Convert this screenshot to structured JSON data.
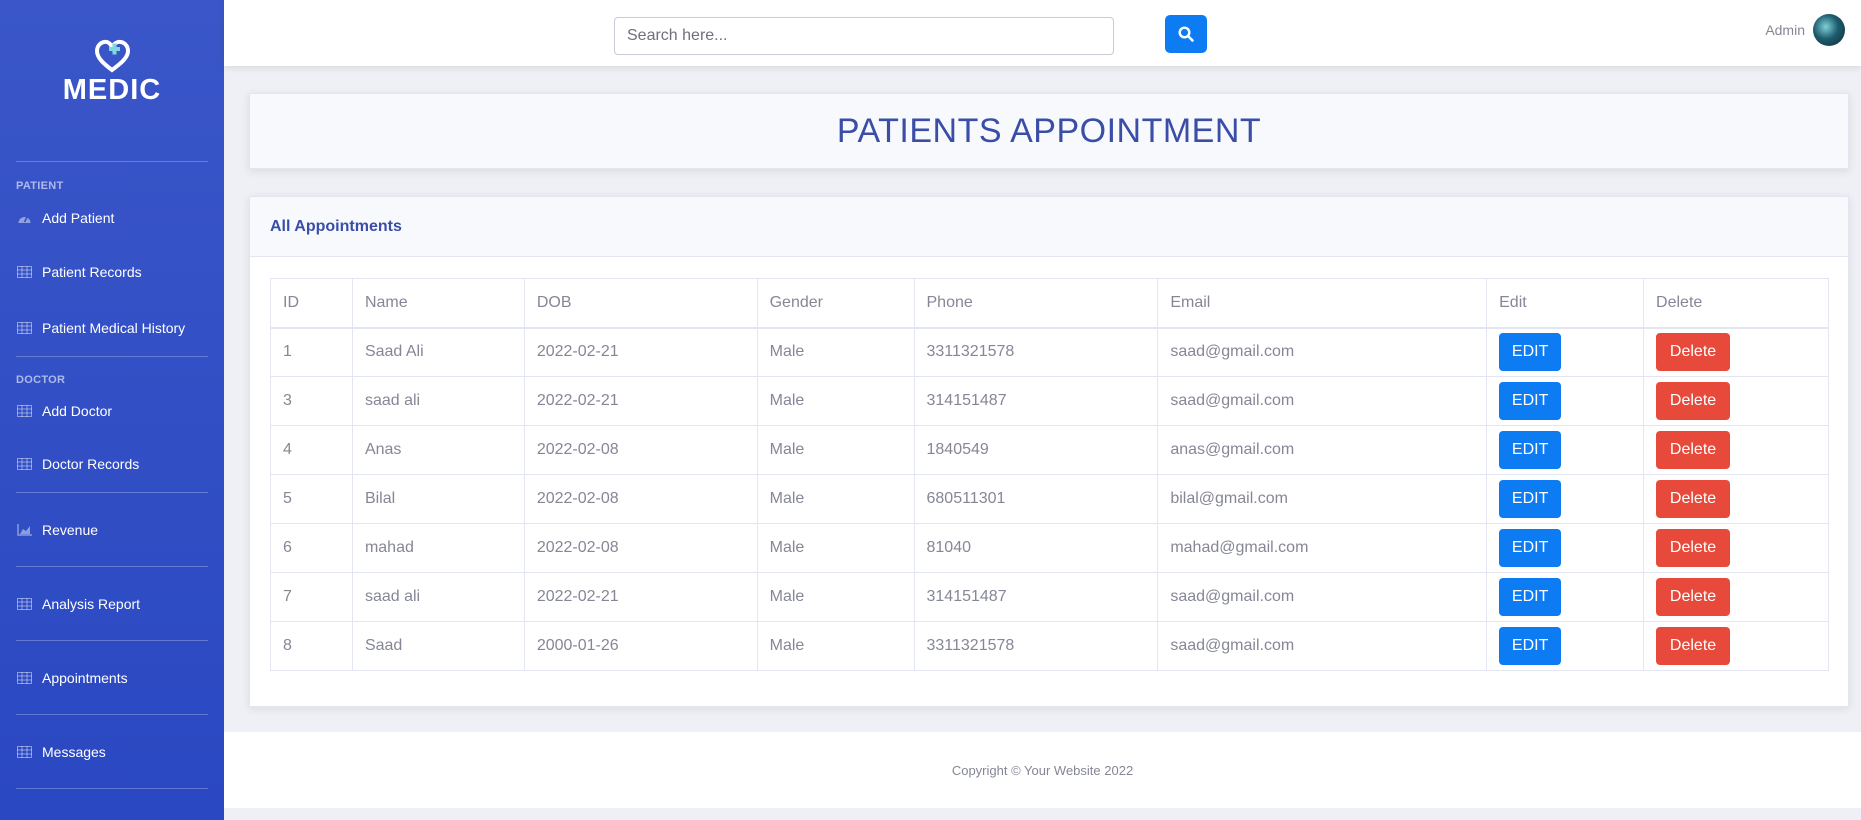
{
  "brand": {
    "name": "MEDIC",
    "logo_icon": "heart-plus-icon"
  },
  "sidebar": {
    "sections": [
      {
        "heading": "PATIENT",
        "items": [
          {
            "label": "Add Patient",
            "icon": "gauge-icon"
          },
          {
            "label": "Patient Records",
            "icon": "table-icon"
          },
          {
            "label": "Patient Medical History",
            "icon": "table-icon"
          }
        ]
      },
      {
        "heading": "DOCTOR",
        "items": [
          {
            "label": "Add Doctor",
            "icon": "table-icon"
          },
          {
            "label": "Doctor Records",
            "icon": "table-icon"
          }
        ]
      }
    ],
    "links": [
      {
        "label": "Revenue",
        "icon": "chart-area-icon"
      },
      {
        "label": "Analysis Report",
        "icon": "table-icon"
      },
      {
        "label": "Appointments",
        "icon": "table-icon"
      },
      {
        "label": "Messages",
        "icon": "table-icon"
      }
    ]
  },
  "topbar": {
    "search_placeholder": "Search here...",
    "search_icon": "search-icon",
    "user_name": "Admin"
  },
  "page": {
    "title": "PATIENTS APPOINTMENT"
  },
  "card": {
    "title": "All Appointments"
  },
  "table": {
    "headers": [
      "ID",
      "Name",
      "DOB",
      "Gender",
      "Phone",
      "Email",
      "Edit",
      "Delete"
    ],
    "edit_label": "EDIT",
    "delete_label": "Delete",
    "rows": [
      {
        "id": "1",
        "name": "Saad Ali",
        "dob": "2022-02-21",
        "gender": "Male",
        "phone": "3311321578",
        "email": "saad@gmail.com"
      },
      {
        "id": "3",
        "name": "saad ali",
        "dob": "2022-02-21",
        "gender": "Male",
        "phone": "314151487",
        "email": "saad@gmail.com"
      },
      {
        "id": "4",
        "name": "Anas",
        "dob": "2022-02-08",
        "gender": "Male",
        "phone": "1840549",
        "email": "anas@gmail.com"
      },
      {
        "id": "5",
        "name": "Bilal",
        "dob": "2022-02-08",
        "gender": "Male",
        "phone": "680511301",
        "email": "bilal@gmail.com"
      },
      {
        "id": "6",
        "name": "mahad",
        "dob": "2022-02-08",
        "gender": "Male",
        "phone": "81040",
        "email": "mahad@gmail.com"
      },
      {
        "id": "7",
        "name": "saad ali",
        "dob": "2022-02-21",
        "gender": "Male",
        "phone": "314151487",
        "email": "saad@gmail.com"
      },
      {
        "id": "8",
        "name": "Saad",
        "dob": "2000-01-26",
        "gender": "Male",
        "phone": "3311321578",
        "email": "saad@gmail.com"
      }
    ]
  },
  "footer": {
    "text": "Copyright © Your Website 2022"
  },
  "colors": {
    "sidebar": "#2f4ec4",
    "primary": "#0d7bf2",
    "danger": "#e74a3b",
    "heading": "#3a4ea8"
  }
}
